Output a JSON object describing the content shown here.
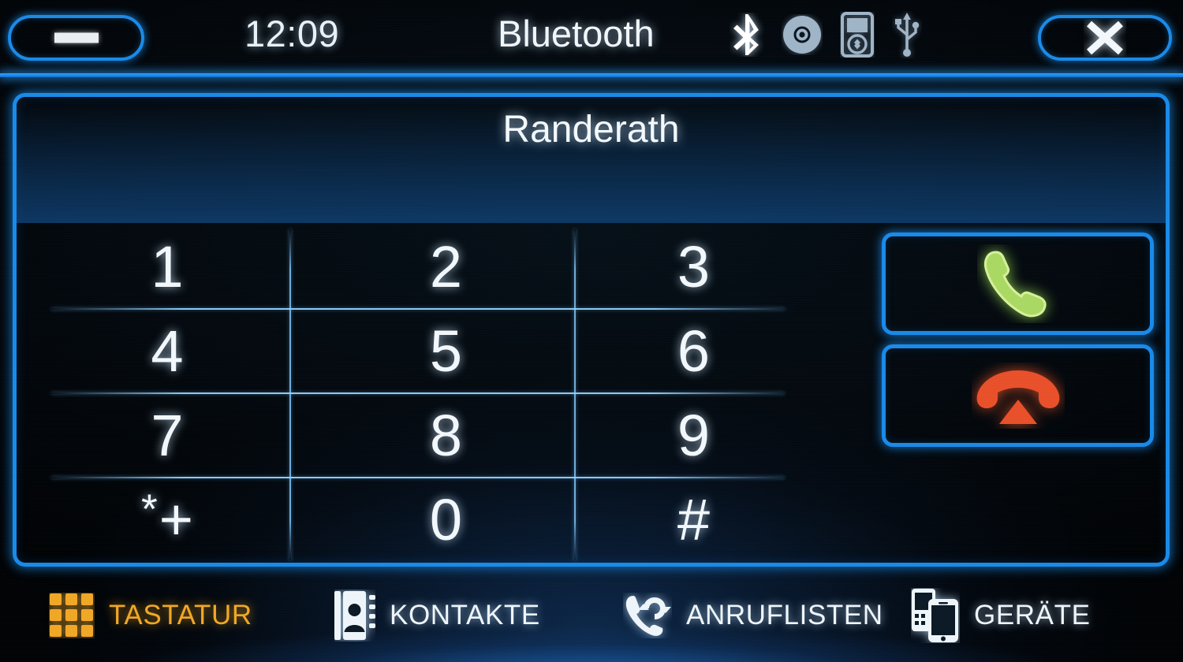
{
  "header": {
    "minimize_label": "minimize",
    "clock": "12:09",
    "title": "Bluetooth",
    "close_label": "close",
    "status_icons": [
      {
        "name": "bluetooth-icon",
        "state": "active"
      },
      {
        "name": "disc-icon",
        "state": "inactive"
      },
      {
        "name": "media-player-icon",
        "state": "inactive"
      },
      {
        "name": "usb-icon",
        "state": "inactive"
      }
    ]
  },
  "panel": {
    "entry_value": "Randerath",
    "entry_placeholder": "",
    "keypad": {
      "rows": [
        [
          {
            "key": "1",
            "sub": ""
          },
          {
            "key": "2",
            "sub": ""
          },
          {
            "key": "3",
            "sub": ""
          }
        ],
        [
          {
            "key": "4",
            "sub": ""
          },
          {
            "key": "5",
            "sub": ""
          },
          {
            "key": "6",
            "sub": ""
          }
        ],
        [
          {
            "key": "7",
            "sub": ""
          },
          {
            "key": "8",
            "sub": ""
          },
          {
            "key": "9",
            "sub": ""
          }
        ],
        [
          {
            "key": "*+",
            "sub": ""
          },
          {
            "key": "0",
            "sub": ""
          },
          {
            "key": "#",
            "sub": ""
          }
        ]
      ],
      "star_key_upper": "*",
      "star_key_lower": "+"
    },
    "actions": {
      "call_label": "call",
      "end_call_label": "end call"
    }
  },
  "tabbar": {
    "tabs": [
      {
        "id": "tastatur",
        "label": "TASTATUR",
        "icon": "keypad-grid-icon",
        "active": true
      },
      {
        "id": "kontakte",
        "label": "KONTAKTE",
        "icon": "address-book-icon",
        "active": false
      },
      {
        "id": "anruflisten",
        "label": "ANRUFLISTEN",
        "icon": "call-history-icon",
        "active": false
      },
      {
        "id": "geraete",
        "label": "GERÄTE",
        "icon": "devices-icon",
        "active": false
      }
    ]
  },
  "colors": {
    "accent_blue": "#1a8ae8",
    "text_white": "#f0f6fa",
    "active_amber": "#f0a726",
    "call_green": "#a9d963",
    "end_red": "#e8502a",
    "background": "#03080d"
  }
}
